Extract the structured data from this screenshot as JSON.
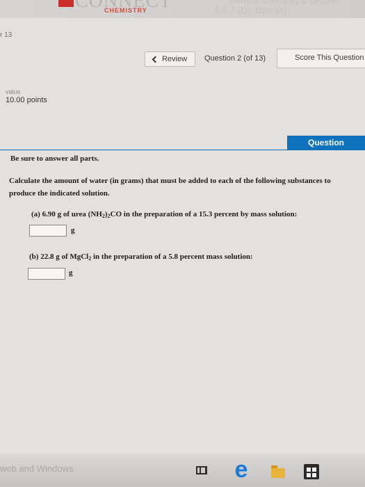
{
  "header": {
    "logo_text": "CONNECT",
    "logo_sub": "CHEMISTRY",
    "course_line1": "General Chemistry & Lecture",
    "course_line2": "5.6.7 (Dr. Dvorak)"
  },
  "question_number_fragment": "r 13",
  "nav": {
    "review_label": "Review",
    "question_position": "Question 2 (of 13)",
    "score_label": "Score This Question"
  },
  "value": {
    "label": "value",
    "points": "10.00 points"
  },
  "question_tab": "Question",
  "content": {
    "instruction": "Be sure to answer all parts.",
    "prompt": "Calculate the amount of water (in grams) that must be added to each of the following substances to produce the indicated solution.",
    "part_a": {
      "prefix": "(a) 6.90 g of urea (NH",
      "sub1": "2",
      "mid": ")",
      "sub2": "2",
      "suffix": "CO in the preparation of a 15.3 percent by mass solution:",
      "answer": "",
      "unit": "g"
    },
    "part_b": {
      "prefix": "(b) 22.8 g of MgCl",
      "sub1": "2",
      "suffix": " in the preparation of a 5.8 percent mass solution:",
      "answer": "",
      "unit": "g"
    }
  },
  "taskbar": {
    "search_text": "web and Windows"
  },
  "colors": {
    "accent": "#0e72bd",
    "brand_red": "#c9302c"
  }
}
